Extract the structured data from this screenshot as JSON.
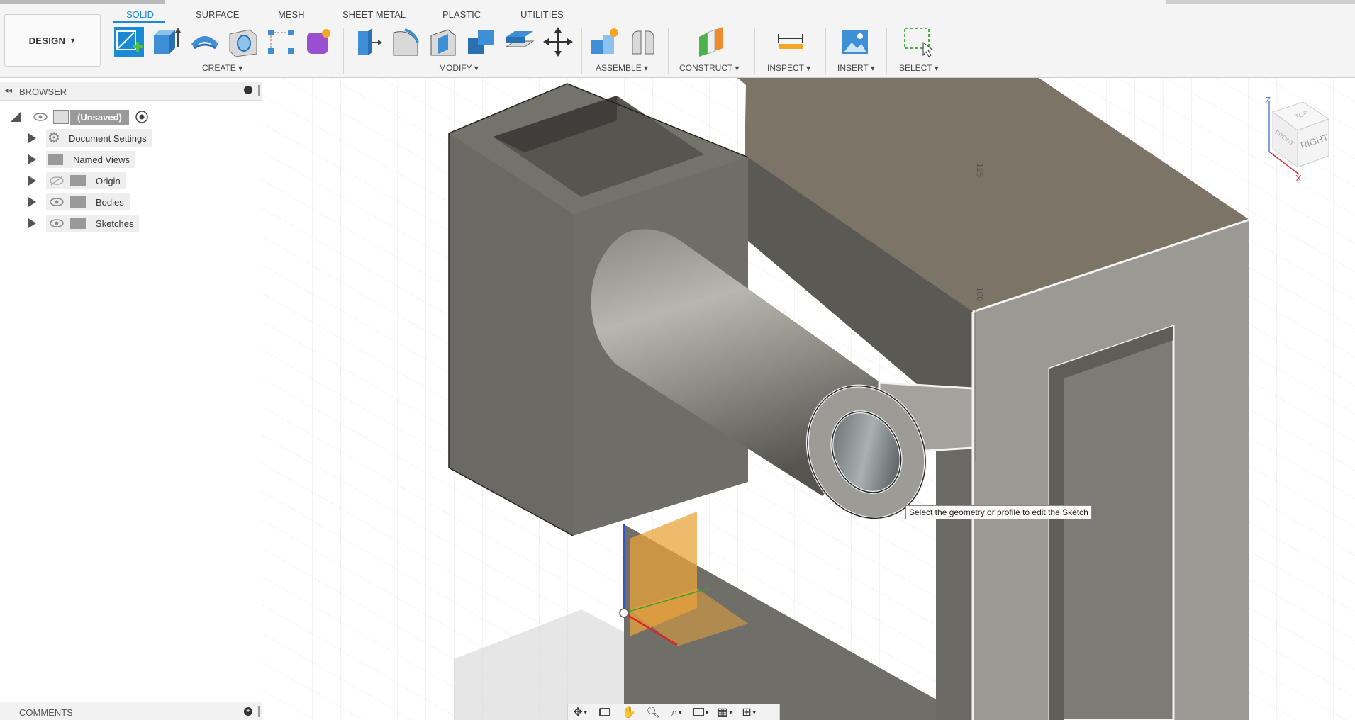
{
  "workspace": {
    "label": "DESIGN"
  },
  "tabs": [
    {
      "label": "SOLID",
      "active": true
    },
    {
      "label": "SURFACE"
    },
    {
      "label": "MESH"
    },
    {
      "label": "SHEET METAL"
    },
    {
      "label": "PLASTIC"
    },
    {
      "label": "UTILITIES"
    }
  ],
  "groups": {
    "create": "CREATE",
    "modify": "MODIFY",
    "assemble": "ASSEMBLE",
    "construct": "CONSTRUCT",
    "inspect": "INSPECT",
    "insert": "INSERT",
    "select": "SELECT"
  },
  "browser": {
    "title": "BROWSER",
    "root": "(Unsaved)",
    "items": [
      {
        "label": "Document Settings",
        "icon": "gear-icon"
      },
      {
        "label": "Named Views",
        "icon": "folder-icon"
      },
      {
        "label": "Origin",
        "icon": "folder-icon",
        "hidden": true
      },
      {
        "label": "Bodies",
        "icon": "folder-icon"
      },
      {
        "label": "Sketches",
        "icon": "folder-icon"
      }
    ]
  },
  "comments": {
    "title": "COMMENTS"
  },
  "viewport": {
    "tooltip": "Select the geometry or profile to edit the Sketch",
    "dimension_125": "125",
    "dimension_100": "100"
  },
  "viewcube": {
    "right": "RIGHT",
    "front": "FRONT",
    "top": "TOP",
    "axis_z": "Z",
    "axis_x": "X"
  },
  "colors": {
    "accent": "#1a8ad4",
    "body": "#77766e",
    "sketch_plane": "#e8a33a"
  }
}
